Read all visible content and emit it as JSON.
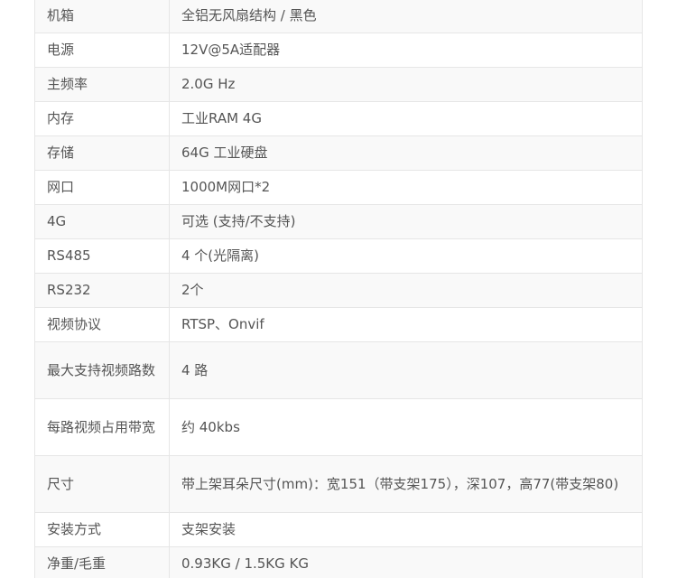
{
  "specs": [
    {
      "label": "机箱",
      "value": "全铝无风扇结构 / 黑色"
    },
    {
      "label": "电源",
      "value": "12V@5A适配器"
    },
    {
      "label": "主频率",
      "value": "2.0G Hz"
    },
    {
      "label": "内存",
      "value": "工业RAM 4G"
    },
    {
      "label": "存储",
      "value": "64G 工业硬盘"
    },
    {
      "label": "网口",
      "value": "1000M网口*2"
    },
    {
      "label": "4G",
      "value": "可选 (支持/不支持)"
    },
    {
      "label": "RS485",
      "value": "4 个(光隔离)"
    },
    {
      "label": "RS232",
      "value": "2个"
    },
    {
      "label": "视频协议",
      "value": "RTSP、Onvif"
    },
    {
      "label": "最大支持视频路数",
      "value": "4 路"
    },
    {
      "label": "每路视频占用带宽",
      "value": "约 40kbs"
    },
    {
      "label": "尺寸",
      "value": "带上架耳朵尺寸(mm)：宽151（带支架175），深107，高77(带支架80)"
    },
    {
      "label": "安装方式",
      "value": "支架安装"
    },
    {
      "label": "净重/毛重",
      "value": "0.93KG / 1.5KG KG"
    }
  ]
}
